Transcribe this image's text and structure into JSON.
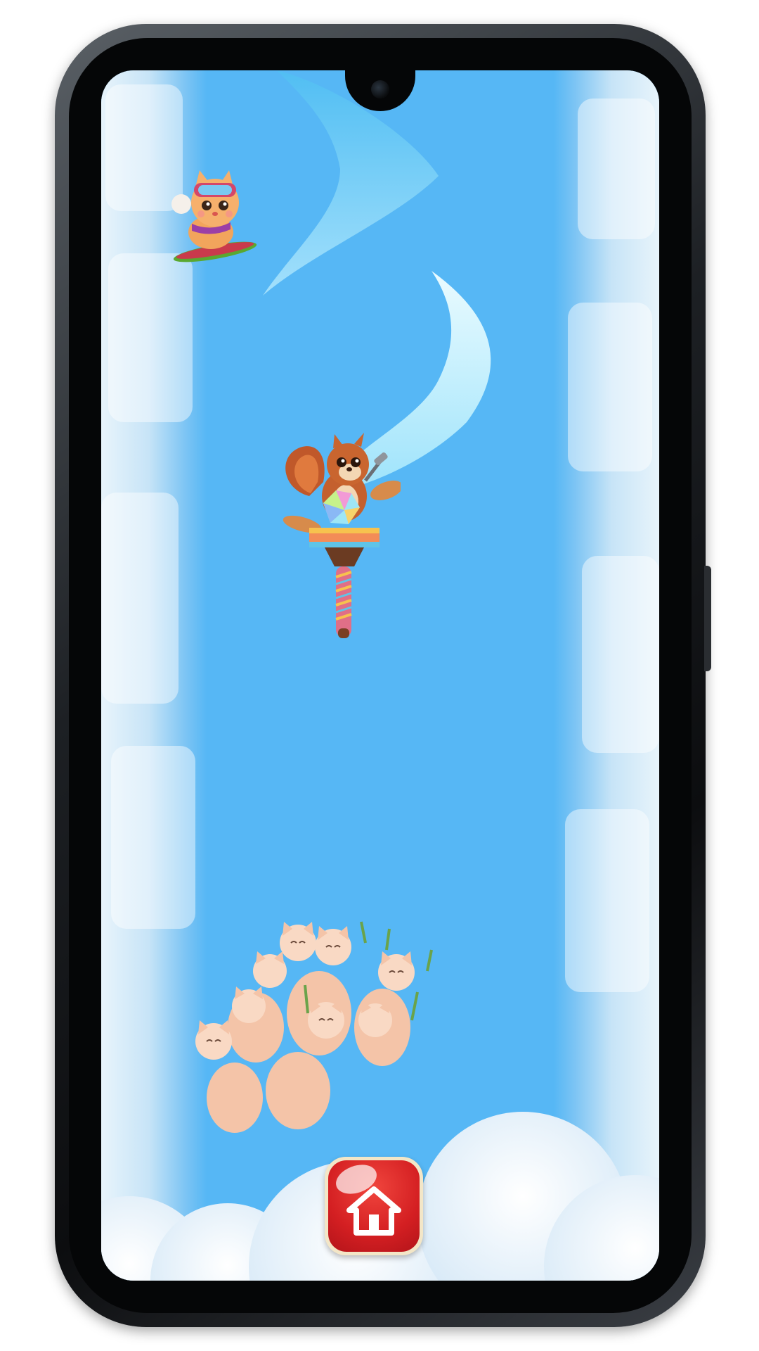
{
  "game": {
    "scene": "ice-slope",
    "player": {
      "character": "squirrel",
      "vehicle": "gem-pogo-stick"
    },
    "opponent": {
      "character": "cat",
      "vehicle": "snowboard"
    },
    "crowd": {
      "character": "cats"
    }
  },
  "controls": {
    "home_button": {
      "icon": "home-icon"
    }
  },
  "colors": {
    "sky": "#56b7f5",
    "trail": "#bfeefd",
    "home_button": "#d41f22",
    "cloud": "#eef6fc"
  }
}
